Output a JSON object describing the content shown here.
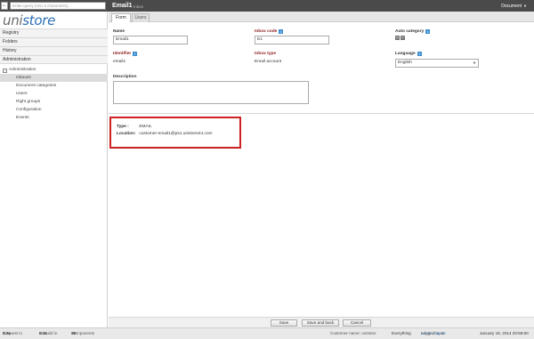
{
  "topbar": {
    "back_icon": "arrow-left-icon",
    "search_placeholder": "Enter query (min 3 characters)...",
    "title": "Email1",
    "subtitle": "Inbox",
    "document_menu": "Document"
  },
  "sidebar": {
    "logo_uni": "uni",
    "logo_store": "store",
    "sections": [
      "Registry",
      "Folders",
      "History",
      "Administration"
    ],
    "admin_root": "Administration",
    "admin_items": [
      "Inboxes",
      "Document categories",
      "Users",
      "Right groups",
      "Configuration",
      "Events"
    ],
    "selected_item": "Inboxes"
  },
  "tabs": {
    "form": "Form",
    "users": "Users"
  },
  "form": {
    "name_label": "Name",
    "name_value": "Email1",
    "inbox_code_label": "Inbox code",
    "inbox_code_value": "E1",
    "auto_category_label": "Auto category",
    "identifier_label": "Identifier",
    "identifier_value": "email1",
    "inbox_type_label": "Inbox type",
    "inbox_type_value": "Email account",
    "language_label": "Language",
    "language_value": "English",
    "description_label": "Description",
    "description_value": ""
  },
  "info_box": {
    "type_key": "Type :",
    "type_value": "EMAIL",
    "location_key": "Location:",
    "location_value": "customer-email1@ps1.unistore24.com"
  },
  "buttons": {
    "save": "Save",
    "save_and_back": "Save and back",
    "cancel": "Cancel"
  },
  "status": {
    "request_label": "Request in",
    "request_value": "0.2s",
    "rebuild_label": "Rebuild in",
    "rebuild_value": "0.1s",
    "components_label": "Components",
    "components_value": "30",
    "customer_label": "Customer name: unistore",
    "scope": "Everything",
    "logged_in_label": "Logged in as",
    "user": "admin",
    "logout": "logout",
    "datetime": "January 18, 2014 20:58:50"
  },
  "colors": {
    "accent": "#2a6fb6",
    "required_label": "#8b1a1a",
    "highlight_border": "#cc2222",
    "topbar": "#4a4a4a"
  }
}
